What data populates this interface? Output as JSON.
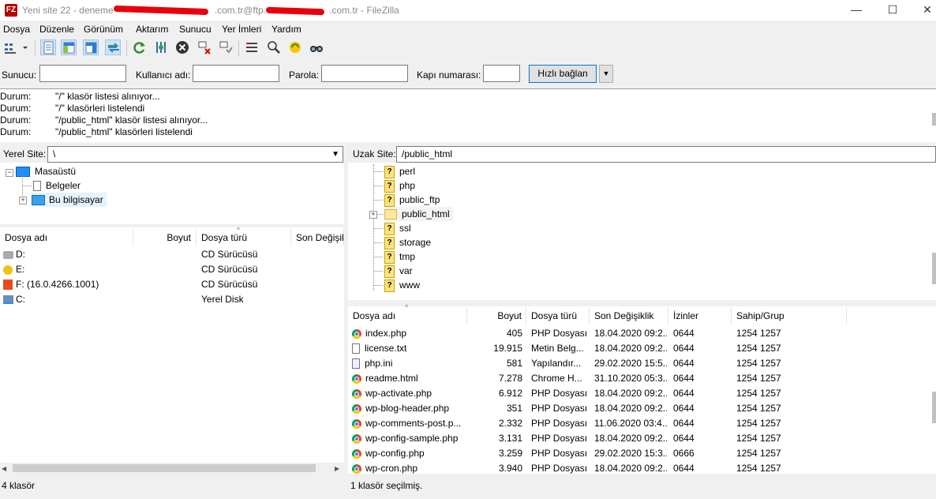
{
  "window": {
    "title_prefix": "Yeni site 22 - deneme",
    "title_mid": ".com.tr@ftp.",
    "title_suffix": ".com.tr - FileZilla",
    "app_icon_text": "FZ",
    "minimize": "—",
    "maximize": "☐",
    "close": "✕"
  },
  "menu": [
    "Dosya",
    "Düzenle",
    "Görünüm",
    "Aktarım",
    "Sunucu",
    "Yer İmleri",
    "Yardım"
  ],
  "toolbar": {
    "icons": [
      "site-manager-icon",
      "message-log-icon",
      "local-tree-icon",
      "remote-tree-icon",
      "transfer-queue-icon",
      "refresh-icon",
      "process-queue-icon",
      "cancel-icon",
      "disconnect-icon",
      "reconnect-icon",
      "filter-icon",
      "compare-icon",
      "sync-browse-icon",
      "search-icon"
    ]
  },
  "quickconnect": {
    "host_label": "Sunucu:",
    "user_label": "Kullanıcı adı:",
    "pass_label": "Parola:",
    "port_label": "Kapı numarası:",
    "connect_label": "Hızlı bağlan"
  },
  "log": [
    {
      "label": "Durum:",
      "msg": "\"/\" klasör listesi alınıyor..."
    },
    {
      "label": "Durum:",
      "msg": "\"/\" klasörleri listelendi"
    },
    {
      "label": "Durum:",
      "msg": "\"/public_html\" klasör listesi alınıyor..."
    },
    {
      "label": "Durum:",
      "msg": "\"/public_html\" klasörleri listelendi"
    }
  ],
  "local": {
    "site_label": "Yerel Site:",
    "path": "\\",
    "tree": [
      {
        "label": "Masaüstü",
        "level": 0
      },
      {
        "label": "Belgeler",
        "level": 1
      },
      {
        "label": "Bu bilgisayar",
        "level": 1
      }
    ],
    "columns": [
      "Dosya adı",
      "Boyut",
      "Dosya türü",
      "Son Değişik"
    ],
    "files": [
      {
        "name": "D:",
        "size": "",
        "type": "CD Sürücüsü",
        "icon": "cd-drive-icon"
      },
      {
        "name": "E:",
        "size": "",
        "type": "CD Sürücüsü",
        "icon": "cd-drive-icon"
      },
      {
        "name": "F: (16.0.4266.1001)",
        "size": "",
        "type": "CD Sürücüsü",
        "icon": "office-drive-icon"
      },
      {
        "name": "C:",
        "size": "",
        "type": "Yerel Disk",
        "icon": "hard-disk-icon"
      }
    ],
    "status": "4 klasör"
  },
  "remote": {
    "site_label": "Uzak Site:",
    "path": "/public_html",
    "tree": [
      "perl",
      "php",
      "public_ftp",
      "public_html",
      "ssl",
      "storage",
      "tmp",
      "var",
      "www"
    ],
    "tree_selected": "public_html",
    "columns": [
      "Dosya adı",
      "Boyut",
      "Dosya türü",
      "Son Değişiklik",
      "İzinler",
      "Sahip/Grup"
    ],
    "files": [
      {
        "name": "index.php",
        "size": "405",
        "type": "PHP Dosyası",
        "modified": "18.04.2020 09:2...",
        "perm": "0644",
        "owner": "1254 1257",
        "icon": "chrome-icon"
      },
      {
        "name": "license.txt",
        "size": "19.915",
        "type": "Metin Belg...",
        "modified": "18.04.2020 09:2...",
        "perm": "0644",
        "owner": "1254 1257",
        "icon": "text-file-icon"
      },
      {
        "name": "php.ini",
        "size": "581",
        "type": "Yapılandır...",
        "modified": "29.02.2020 15:5...",
        "perm": "0644",
        "owner": "1254 1257",
        "icon": "config-file-icon"
      },
      {
        "name": "readme.html",
        "size": "7.278",
        "type": "Chrome H...",
        "modified": "31.10.2020 05:3...",
        "perm": "0644",
        "owner": "1254 1257",
        "icon": "chrome-icon"
      },
      {
        "name": "wp-activate.php",
        "size": "6.912",
        "type": "PHP Dosyası",
        "modified": "18.04.2020 09:2...",
        "perm": "0644",
        "owner": "1254 1257",
        "icon": "chrome-icon"
      },
      {
        "name": "wp-blog-header.php",
        "size": "351",
        "type": "PHP Dosyası",
        "modified": "18.04.2020 09:2...",
        "perm": "0644",
        "owner": "1254 1257",
        "icon": "chrome-icon"
      },
      {
        "name": "wp-comments-post.p...",
        "size": "2.332",
        "type": "PHP Dosyası",
        "modified": "11.06.2020 03:4...",
        "perm": "0644",
        "owner": "1254 1257",
        "icon": "chrome-icon"
      },
      {
        "name": "wp-config-sample.php",
        "size": "3.131",
        "type": "PHP Dosyası",
        "modified": "18.04.2020 09:2...",
        "perm": "0644",
        "owner": "1254 1257",
        "icon": "chrome-icon"
      },
      {
        "name": "wp-config.php",
        "size": "3.259",
        "type": "PHP Dosyası",
        "modified": "29.02.2020 15:3...",
        "perm": "0666",
        "owner": "1254 1257",
        "icon": "chrome-icon"
      },
      {
        "name": "wp-cron.php",
        "size": "3.940",
        "type": "PHP Dosyası",
        "modified": "18.04.2020 09:2...",
        "perm": "0644",
        "owner": "1254 1257",
        "icon": "chrome-icon"
      }
    ],
    "status": "1 klasör seçilmiş."
  }
}
